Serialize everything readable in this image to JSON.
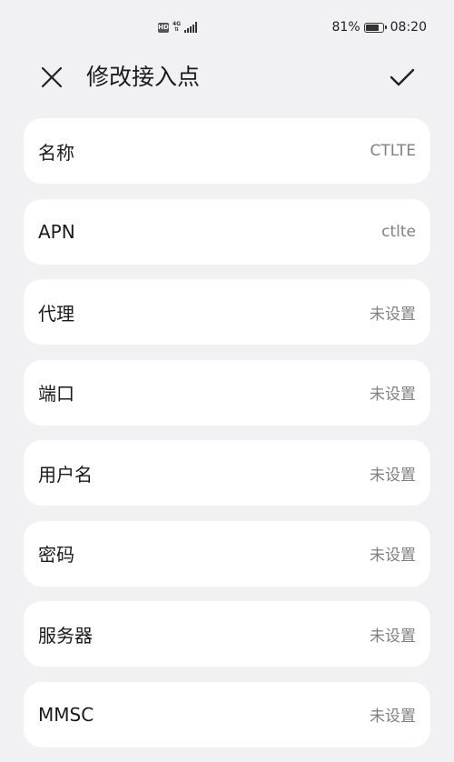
{
  "status_bar": {
    "badge": "HD",
    "network_top": "4G",
    "network_bottom": "⇅",
    "battery_text": "81%",
    "battery_level": 0.81,
    "time": "08:20"
  },
  "header": {
    "close_icon": "close-icon",
    "title": "修改接入点",
    "confirm_icon": "check-icon"
  },
  "fields": [
    {
      "label": "名称",
      "value": "CTLTE"
    },
    {
      "label": "APN",
      "value": "ctlte"
    },
    {
      "label": "代理",
      "value": "未设置"
    },
    {
      "label": "端口",
      "value": "未设置"
    },
    {
      "label": "用户名",
      "value": "未设置"
    },
    {
      "label": "密码",
      "value": "未设置"
    },
    {
      "label": "服务器",
      "value": "未设置"
    },
    {
      "label": "MMSC",
      "value": "未设置"
    }
  ]
}
